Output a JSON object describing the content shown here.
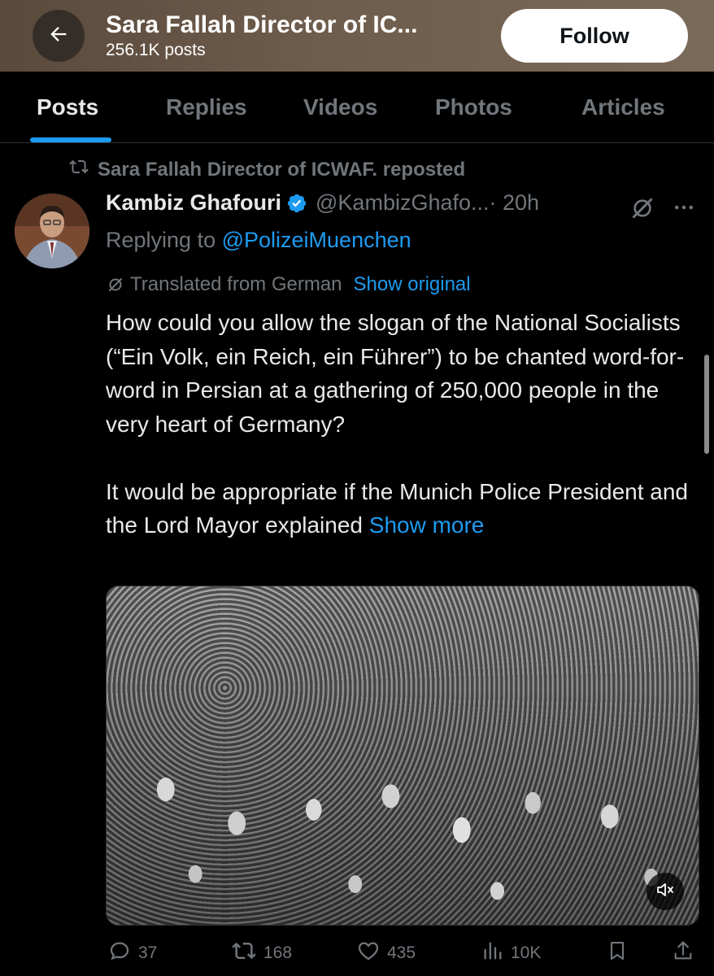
{
  "header": {
    "title": "Sara Fallah Director of IC...",
    "subtitle": "256.1K posts",
    "follow_label": "Follow",
    "back_icon": "arrow-left-icon"
  },
  "tabs": [
    {
      "label": "Posts",
      "active": true
    },
    {
      "label": "Replies",
      "active": false
    },
    {
      "label": "Videos",
      "active": false
    },
    {
      "label": "Photos",
      "active": false
    },
    {
      "label": "Articles",
      "active": false
    }
  ],
  "post": {
    "repost_text": "Sara Fallah Director of ICWAF. reposted",
    "author_name": "Kambiz Ghafouri",
    "handle": "@KambizGhafo...",
    "time": "· 20h",
    "replying_prefix": "Replying to",
    "replying_to": "@PolizeiMuenchen",
    "translated_label": "Translated from German",
    "show_original": "Show original",
    "text_p1": "How could you allow the slogan of the National Socialists (“Ein Volk, ein Reich, ein Führer”) to be chanted word-for-word in Persian at a gathering of 250,000 people in the very heart of Germany?",
    "text_p2": "It would be appropriate if the Munich Police President and the Lord Mayor explained",
    "show_more": "Show more",
    "stats": {
      "replies": "37",
      "reposts": "168",
      "likes": "435",
      "views": "10K"
    }
  },
  "colors": {
    "accent": "#1d9bf0",
    "background": "#000000",
    "muted": "#71767b",
    "text": "#e7e9ea"
  }
}
